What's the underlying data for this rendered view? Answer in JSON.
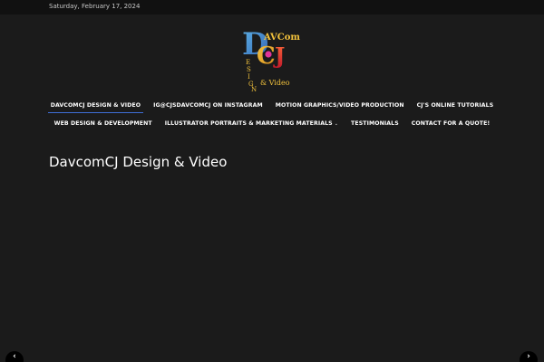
{
  "topbar": {
    "date": "Saturday, February 17, 2024"
  },
  "logo": {
    "name": "DavCom CJ Design & Video",
    "icon": "davcom-logo"
  },
  "nav": {
    "row1": [
      {
        "label": "DAVCOMCJ DESIGN & VIDEO",
        "active": true
      },
      {
        "label": "IG@CJSDAVCOMCJ ON INSTAGRAM"
      },
      {
        "label": "MOTION GRAPHICS/VIDEO PRODUCTION"
      },
      {
        "label": "CJ'S ONLINE TUTORIALS"
      }
    ],
    "row2": [
      {
        "label": "WEB DESIGN & DEVELOPMENT"
      },
      {
        "label": "ILLUSTRATOR PORTRAITS & MARKETING MATERIALS",
        "caret": "⌄"
      },
      {
        "label": "TESTIMONIALS"
      },
      {
        "label": "CONTACT FOR A QUOTE!"
      }
    ]
  },
  "main": {
    "title": "DavcomCJ Design & Video"
  },
  "slider": {
    "prev": "‹",
    "next": "›"
  },
  "colors": {
    "accent": "#3f6fd8",
    "background": "#1b1b1b",
    "topbar": "#111111"
  }
}
